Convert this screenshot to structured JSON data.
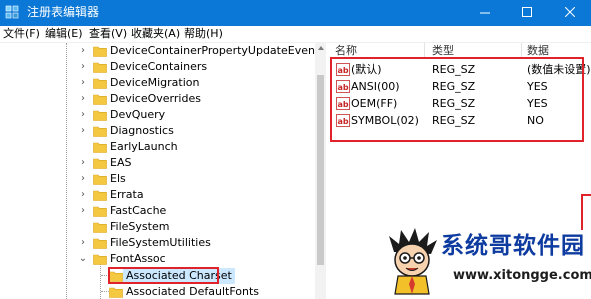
{
  "window": {
    "title": "注册表编辑器",
    "minimize_glyph": "—",
    "close_glyph": "✕"
  },
  "menu": [
    "文件(F)",
    "编辑(E)",
    "查看(V)",
    "收藏夹(A)",
    "帮助(H)"
  ],
  "tree": {
    "items": [
      {
        "label": "DeviceContainerPropertyUpdateEvents",
        "expander": "›"
      },
      {
        "label": "DeviceContainers",
        "expander": "›"
      },
      {
        "label": "DeviceMigration",
        "expander": "›"
      },
      {
        "label": "DeviceOverrides",
        "expander": "›"
      },
      {
        "label": "DevQuery",
        "expander": "›"
      },
      {
        "label": "Diagnostics",
        "expander": "›"
      },
      {
        "label": "EarlyLaunch",
        "expander": ""
      },
      {
        "label": "EAS",
        "expander": "›"
      },
      {
        "label": "Els",
        "expander": "›"
      },
      {
        "label": "Errata",
        "expander": "›"
      },
      {
        "label": "FastCache",
        "expander": "›"
      },
      {
        "label": "FileSystem",
        "expander": ""
      },
      {
        "label": "FileSystemUtilities",
        "expander": "›"
      },
      {
        "label": "FontAssoc",
        "expander": "⌄"
      }
    ],
    "sub_items": [
      {
        "label": "Associated Charset",
        "selected": true
      },
      {
        "label": "Associated DefaultFonts",
        "selected": false
      }
    ]
  },
  "values": {
    "columns": [
      "名称",
      "类型",
      "数据"
    ],
    "rows": [
      {
        "name": "(默认)",
        "type": "REG_SZ",
        "data": "(数值未设置)"
      },
      {
        "name": "ANSI(00)",
        "type": "REG_SZ",
        "data": "YES"
      },
      {
        "name": "OEM(FF)",
        "type": "REG_SZ",
        "data": "YES"
      },
      {
        "name": "SYMBOL(02)",
        "type": "REG_SZ",
        "data": "NO"
      }
    ]
  },
  "watermark": {
    "brand": "系统哥软件园",
    "url": "www.xitongge.com"
  },
  "colors": {
    "titlebar": "#0b78d7",
    "highlight": "#e0232b",
    "folder": "#f5c842",
    "brand": "#0e3ba0"
  }
}
